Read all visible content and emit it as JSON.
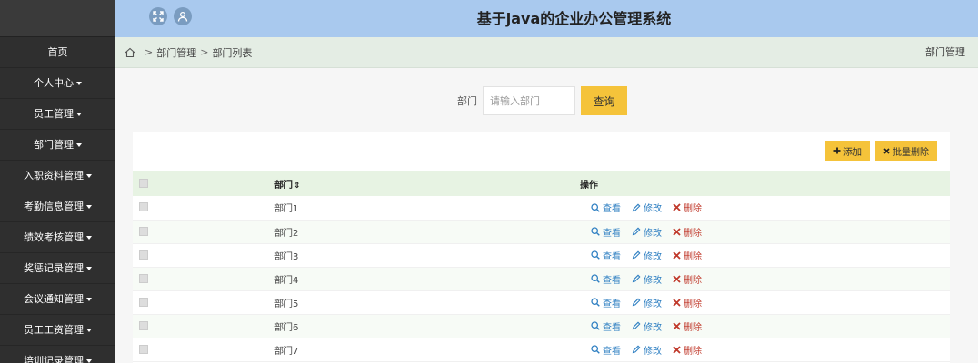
{
  "header": {
    "title": "基于java的企业办公管理系统"
  },
  "sidebar": {
    "items": [
      {
        "label": "首页",
        "caret": false
      },
      {
        "label": "个人中心",
        "caret": true
      },
      {
        "label": "员工管理",
        "caret": true
      },
      {
        "label": "部门管理",
        "caret": true
      },
      {
        "label": "入职资料管理",
        "caret": true
      },
      {
        "label": "考勤信息管理",
        "caret": true
      },
      {
        "label": "绩效考核管理",
        "caret": true
      },
      {
        "label": "奖惩记录管理",
        "caret": true
      },
      {
        "label": "会议通知管理",
        "caret": true
      },
      {
        "label": "员工工资管理",
        "caret": true
      },
      {
        "label": "培训记录管理",
        "caret": true
      }
    ]
  },
  "breadcrumb": {
    "sep": ">",
    "level1": "部门管理",
    "level2": "部门列表",
    "right": "部门管理"
  },
  "search": {
    "label": "部门",
    "placeholder": "请输入部门",
    "button": "查询"
  },
  "toolbar": {
    "add_label": "添加",
    "batch_delete_label": "批量删除"
  },
  "table": {
    "columns": [
      "部门",
      "操作"
    ],
    "sort_glyph": "⇕",
    "rows": [
      "部门1",
      "部门2",
      "部门3",
      "部门4",
      "部门5",
      "部门6",
      "部门7"
    ],
    "ops": {
      "view": "查看",
      "edit": "修改",
      "delete": "删除"
    }
  },
  "colors": {
    "header_bg": "#a9c9ee",
    "sidebar_bg": "#2f2f2f",
    "accent_button": "#f5c33a",
    "link_blue": "#2e7fc2",
    "delete_red": "#c0392b"
  }
}
